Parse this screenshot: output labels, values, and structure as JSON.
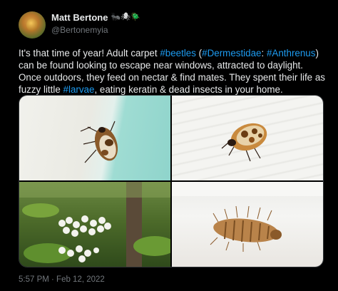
{
  "author": {
    "display_name": "Matt Bertone",
    "name_emoji": "🐜🕷🪲",
    "handle": "@Bertonemyia"
  },
  "tweet": {
    "text_parts": [
      "It's that time of year! Adult carpet ",
      "#beetles",
      " (",
      "#Dermestidae",
      ": ",
      "#Anthrenus",
      ") can be found looking to escape near windows, attracted to daylight. Once outdoors, they feed on nectar & find mates. They spent their life as fuzzy little ",
      "#larvae",
      ", eating keratin & dead insects in your home."
    ],
    "timestamp": "5:57 PM · Feb 12, 2022"
  },
  "media": [
    {
      "icon": "carpet-beetle-on-window-photo"
    },
    {
      "icon": "carpet-beetle-on-wood-photo"
    },
    {
      "icon": "white-flowers-photo"
    },
    {
      "icon": "beetle-larva-photo"
    }
  ],
  "colors": {
    "background": "#000000",
    "text": "#e7e9ea",
    "secondary": "#71767b",
    "link": "#1d9bf0"
  }
}
